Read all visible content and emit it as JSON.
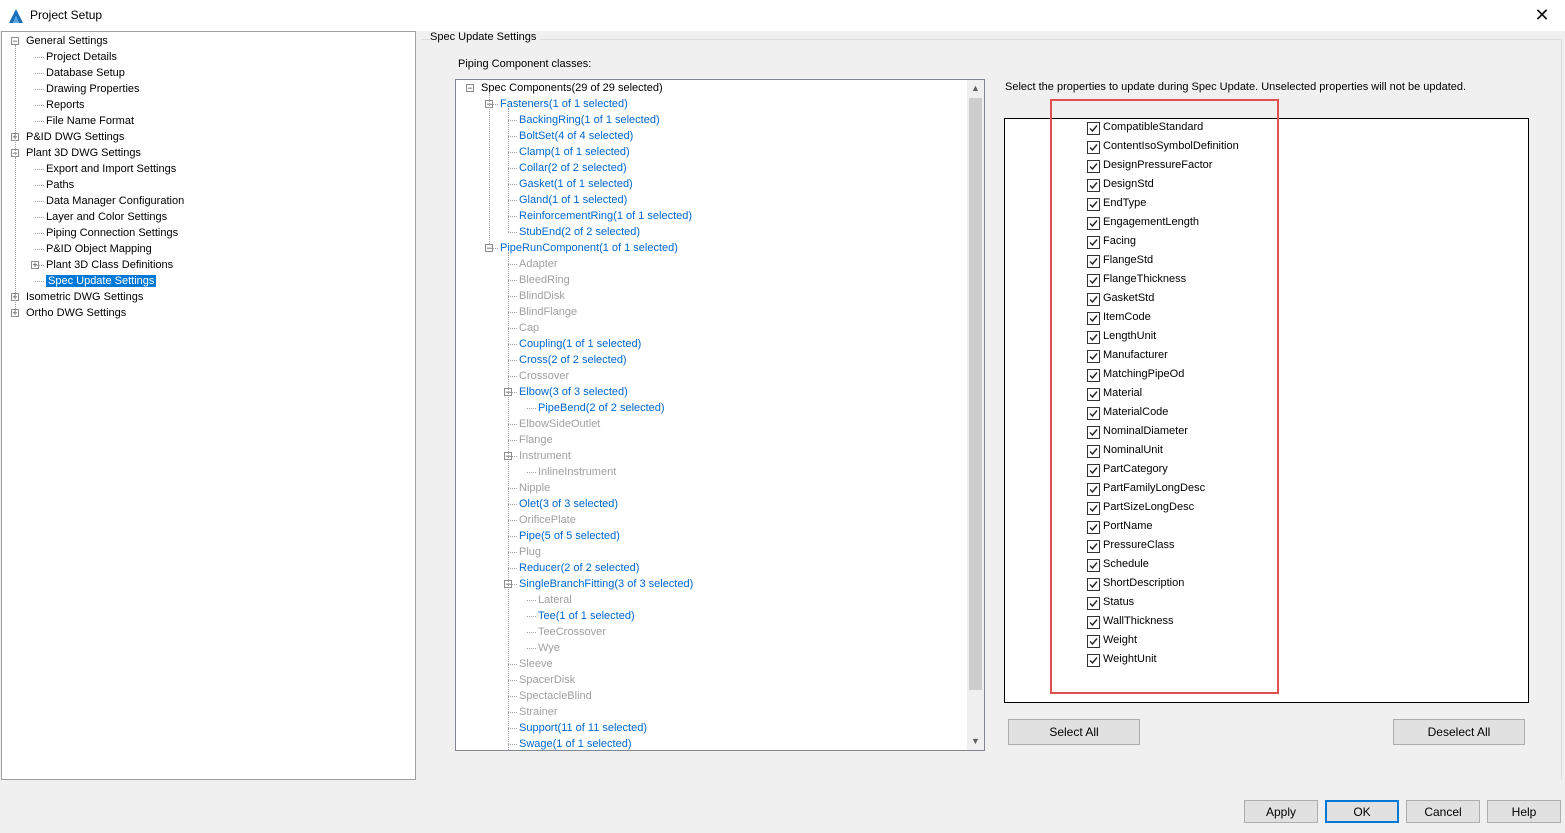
{
  "window": {
    "title": "Project Setup",
    "close_glyph": "✕",
    "logo_icon": "autocad-plant-logo-icon"
  },
  "nav_tree": [
    {
      "label": "General Settings",
      "level": 0,
      "expander": "minus"
    },
    {
      "label": "Project Details",
      "level": 1
    },
    {
      "label": "Database Setup",
      "level": 1
    },
    {
      "label": "Drawing Properties",
      "level": 1
    },
    {
      "label": "Reports",
      "level": 1
    },
    {
      "label": "File Name Format",
      "level": 1
    },
    {
      "label": "P&ID DWG Settings",
      "level": 0,
      "expander": "plus"
    },
    {
      "label": "Plant 3D DWG Settings",
      "level": 0,
      "expander": "minus"
    },
    {
      "label": "Export and Import Settings",
      "level": 1
    },
    {
      "label": "Paths",
      "level": 1
    },
    {
      "label": "Data Manager Configuration",
      "level": 1
    },
    {
      "label": "Layer and Color Settings",
      "level": 1
    },
    {
      "label": "Piping Connection Settings",
      "level": 1
    },
    {
      "label": "P&ID Object Mapping",
      "level": 1
    },
    {
      "label": "Plant 3D Class Definitions",
      "level": 1,
      "expander": "plus"
    },
    {
      "label": "Spec Update Settings",
      "level": 1,
      "selected": true
    },
    {
      "label": "Isometric DWG Settings",
      "level": 0,
      "expander": "plus"
    },
    {
      "label": "Ortho DWG Settings",
      "level": 0,
      "expander": "plus"
    }
  ],
  "spec_update": {
    "section_title": "Spec Update Settings",
    "classes_label": "Piping Component classes:",
    "props_description": "Select the properties to update during Spec Update. Unselected properties will not be updated.",
    "select_all": "Select All",
    "deselect_all": "Deselect All"
  },
  "class_tree": [
    {
      "label": "Spec Components(29 of 29 selected)",
      "level": 0,
      "color": "black",
      "expander": "minus"
    },
    {
      "label": "Fasteners(1 of 1 selected)",
      "level": 1,
      "color": "blue",
      "expander": "minus"
    },
    {
      "label": "BackingRing(1 of 1 selected)",
      "level": 2,
      "color": "blue"
    },
    {
      "label": "BoltSet(4 of 4 selected)",
      "level": 2,
      "color": "blue"
    },
    {
      "label": "Clamp(1 of 1 selected)",
      "level": 2,
      "color": "blue"
    },
    {
      "label": "Collar(2 of 2 selected)",
      "level": 2,
      "color": "blue"
    },
    {
      "label": "Gasket(1 of 1 selected)",
      "level": 2,
      "color": "blue"
    },
    {
      "label": "Gland(1 of 1 selected)",
      "level": 2,
      "color": "blue"
    },
    {
      "label": "ReinforcementRing(1 of 1 selected)",
      "level": 2,
      "color": "blue"
    },
    {
      "label": "StubEnd(2 of 2 selected)",
      "level": 2,
      "color": "blue"
    },
    {
      "label": "PipeRunComponent(1 of 1 selected)",
      "level": 1,
      "color": "blue",
      "expander": "minus"
    },
    {
      "label": "Adapter",
      "level": 2,
      "color": "gray"
    },
    {
      "label": "BleedRing",
      "level": 2,
      "color": "gray"
    },
    {
      "label": "BlindDisk",
      "level": 2,
      "color": "gray"
    },
    {
      "label": "BlindFlange",
      "level": 2,
      "color": "gray"
    },
    {
      "label": "Cap",
      "level": 2,
      "color": "gray"
    },
    {
      "label": "Coupling(1 of 1 selected)",
      "level": 2,
      "color": "blue"
    },
    {
      "label": "Cross(2 of 2 selected)",
      "level": 2,
      "color": "blue"
    },
    {
      "label": "Crossover",
      "level": 2,
      "color": "gray"
    },
    {
      "label": "Elbow(3 of 3 selected)",
      "level": 2,
      "color": "blue",
      "expander": "minus"
    },
    {
      "label": "PipeBend(2 of 2 selected)",
      "level": 3,
      "color": "blue"
    },
    {
      "label": "ElbowSideOutlet",
      "level": 2,
      "color": "gray"
    },
    {
      "label": "Flange",
      "level": 2,
      "color": "gray"
    },
    {
      "label": "Instrument",
      "level": 2,
      "color": "gray",
      "expander": "minus"
    },
    {
      "label": "InlineInstrument",
      "level": 3,
      "color": "gray"
    },
    {
      "label": "Nipple",
      "level": 2,
      "color": "gray"
    },
    {
      "label": "Olet(3 of 3 selected)",
      "level": 2,
      "color": "blue"
    },
    {
      "label": "OrificePlate",
      "level": 2,
      "color": "gray"
    },
    {
      "label": "Pipe(5 of 5 selected)",
      "level": 2,
      "color": "blue"
    },
    {
      "label": "Plug",
      "level": 2,
      "color": "gray"
    },
    {
      "label": "Reducer(2 of 2 selected)",
      "level": 2,
      "color": "blue"
    },
    {
      "label": "SingleBranchFitting(3 of 3 selected)",
      "level": 2,
      "color": "blue",
      "expander": "minus"
    },
    {
      "label": "Lateral",
      "level": 3,
      "color": "gray"
    },
    {
      "label": "Tee(1 of 1 selected)",
      "level": 3,
      "color": "blue"
    },
    {
      "label": "TeeCrossover",
      "level": 3,
      "color": "gray"
    },
    {
      "label": "Wye",
      "level": 3,
      "color": "gray"
    },
    {
      "label": "Sleeve",
      "level": 2,
      "color": "gray"
    },
    {
      "label": "SpacerDisk",
      "level": 2,
      "color": "gray"
    },
    {
      "label": "SpectacleBlind",
      "level": 2,
      "color": "gray"
    },
    {
      "label": "Strainer",
      "level": 2,
      "color": "gray"
    },
    {
      "label": "Support(11 of 11 selected)",
      "level": 2,
      "color": "blue"
    },
    {
      "label": "Swage(1 of 1 selected)",
      "level": 2,
      "color": "blue"
    }
  ],
  "properties": [
    {
      "label": "CompatibleStandard",
      "checked": true
    },
    {
      "label": "ContentIsoSymbolDefinition",
      "checked": true
    },
    {
      "label": "DesignPressureFactor",
      "checked": true
    },
    {
      "label": "DesignStd",
      "checked": true
    },
    {
      "label": "EndType",
      "checked": true
    },
    {
      "label": "EngagementLength",
      "checked": true
    },
    {
      "label": "Facing",
      "checked": true
    },
    {
      "label": "FlangeStd",
      "checked": true
    },
    {
      "label": "FlangeThickness",
      "checked": true
    },
    {
      "label": "GasketStd",
      "checked": true
    },
    {
      "label": "ItemCode",
      "checked": true
    },
    {
      "label": "LengthUnit",
      "checked": true
    },
    {
      "label": "Manufacturer",
      "checked": true
    },
    {
      "label": "MatchingPipeOd",
      "checked": true
    },
    {
      "label": "Material",
      "checked": true
    },
    {
      "label": "MaterialCode",
      "checked": true
    },
    {
      "label": "NominalDiameter",
      "checked": true
    },
    {
      "label": "NominalUnit",
      "checked": true
    },
    {
      "label": "PartCategory",
      "checked": true
    },
    {
      "label": "PartFamilyLongDesc",
      "checked": true
    },
    {
      "label": "PartSizeLongDesc",
      "checked": true
    },
    {
      "label": "PortName",
      "checked": true
    },
    {
      "label": "PressureClass",
      "checked": true
    },
    {
      "label": "Schedule",
      "checked": true
    },
    {
      "label": "ShortDescription",
      "checked": true
    },
    {
      "label": "Status",
      "checked": true
    },
    {
      "label": "WallThickness",
      "checked": true
    },
    {
      "label": "Weight",
      "checked": true
    },
    {
      "label": "WeightUnit",
      "checked": true
    }
  ],
  "footer": {
    "apply": "Apply",
    "ok": "OK",
    "cancel": "Cancel",
    "help": "Help"
  },
  "colors": {
    "link_blue": "#0066cc",
    "disabled_gray": "#a0a0a0",
    "selection": "#0078d7",
    "highlight_box": "#e05050"
  }
}
